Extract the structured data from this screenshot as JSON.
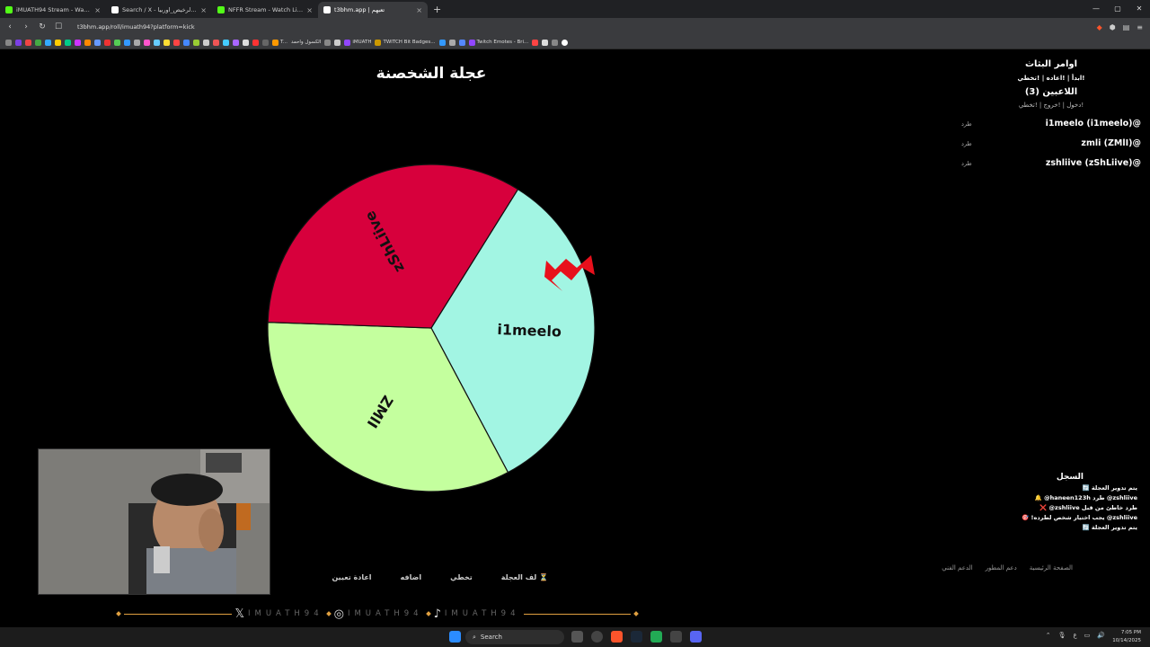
{
  "browser": {
    "tabs": [
      {
        "label": "iMUATH94 Stream - Watch Live o",
        "fav_color": "#53fc18"
      },
      {
        "label": "Search / X - العاني_والرخيص_اوربيا#",
        "fav_color": "#ffffff"
      },
      {
        "label": "NFFR Stream - Watch Live on Kick",
        "fav_color": "#53fc18"
      },
      {
        "label": "t3bhm.app | تعبهم",
        "fav_color": "#ffffff",
        "active": true
      }
    ],
    "new_tab": "+",
    "url": "t3bhm.app/roll/imuath94?platform=kick",
    "bookmarks": [
      "T...",
      "الكسول واحمد",
      "iMUATH",
      "TWITCH Bit Badges...",
      "Twitch Emotes - Bri..."
    ]
  },
  "page": {
    "title": "عجلة الشخصنة",
    "commands_title": "اوامر البثاث",
    "commands": "!ابدأ | !اعاده | !تخطي",
    "players_title": "اللاعبين (3)",
    "players_sub": "!دخول | !خروج | !تخطي",
    "kick_label": "طرد",
    "players": [
      "i1meelo (i1meelo)@",
      "zmli (ZMlI)@",
      "zshliive (zShLiive)@"
    ],
    "log_title": "السجل",
    "log": [
      "يتم تدوير العجلة 🔄",
      "zshliive@ طرد haneen123h@ 🔔",
      "طرد خاطئ من قبل zshliive@ ❌",
      "zshliive@ يجب اختيار شخص لطرده! 🎯",
      "يتم تدوير العجلة 🔄"
    ],
    "footer_links": [
      "الصفحة الرئيسية",
      "دعم المطور",
      "الدعم الفني"
    ],
    "buttons": [
      "لف العجلة ⏳",
      "تخطي",
      "اضافه",
      "اعادة تعيين"
    ],
    "social_handle": "IMUATH94"
  },
  "wheel": {
    "segments": [
      {
        "label": "i1meelo",
        "color": "#a2f5e3"
      },
      {
        "label": "ZMlI",
        "color": "#c4ff9e"
      },
      {
        "label": "zShLiive",
        "color": "#d7003c"
      }
    ],
    "pointer_color": "#e8101c"
  },
  "taskbar": {
    "search_placeholder": "Search",
    "time": "7:05 PM",
    "date": "10/14/2025"
  }
}
